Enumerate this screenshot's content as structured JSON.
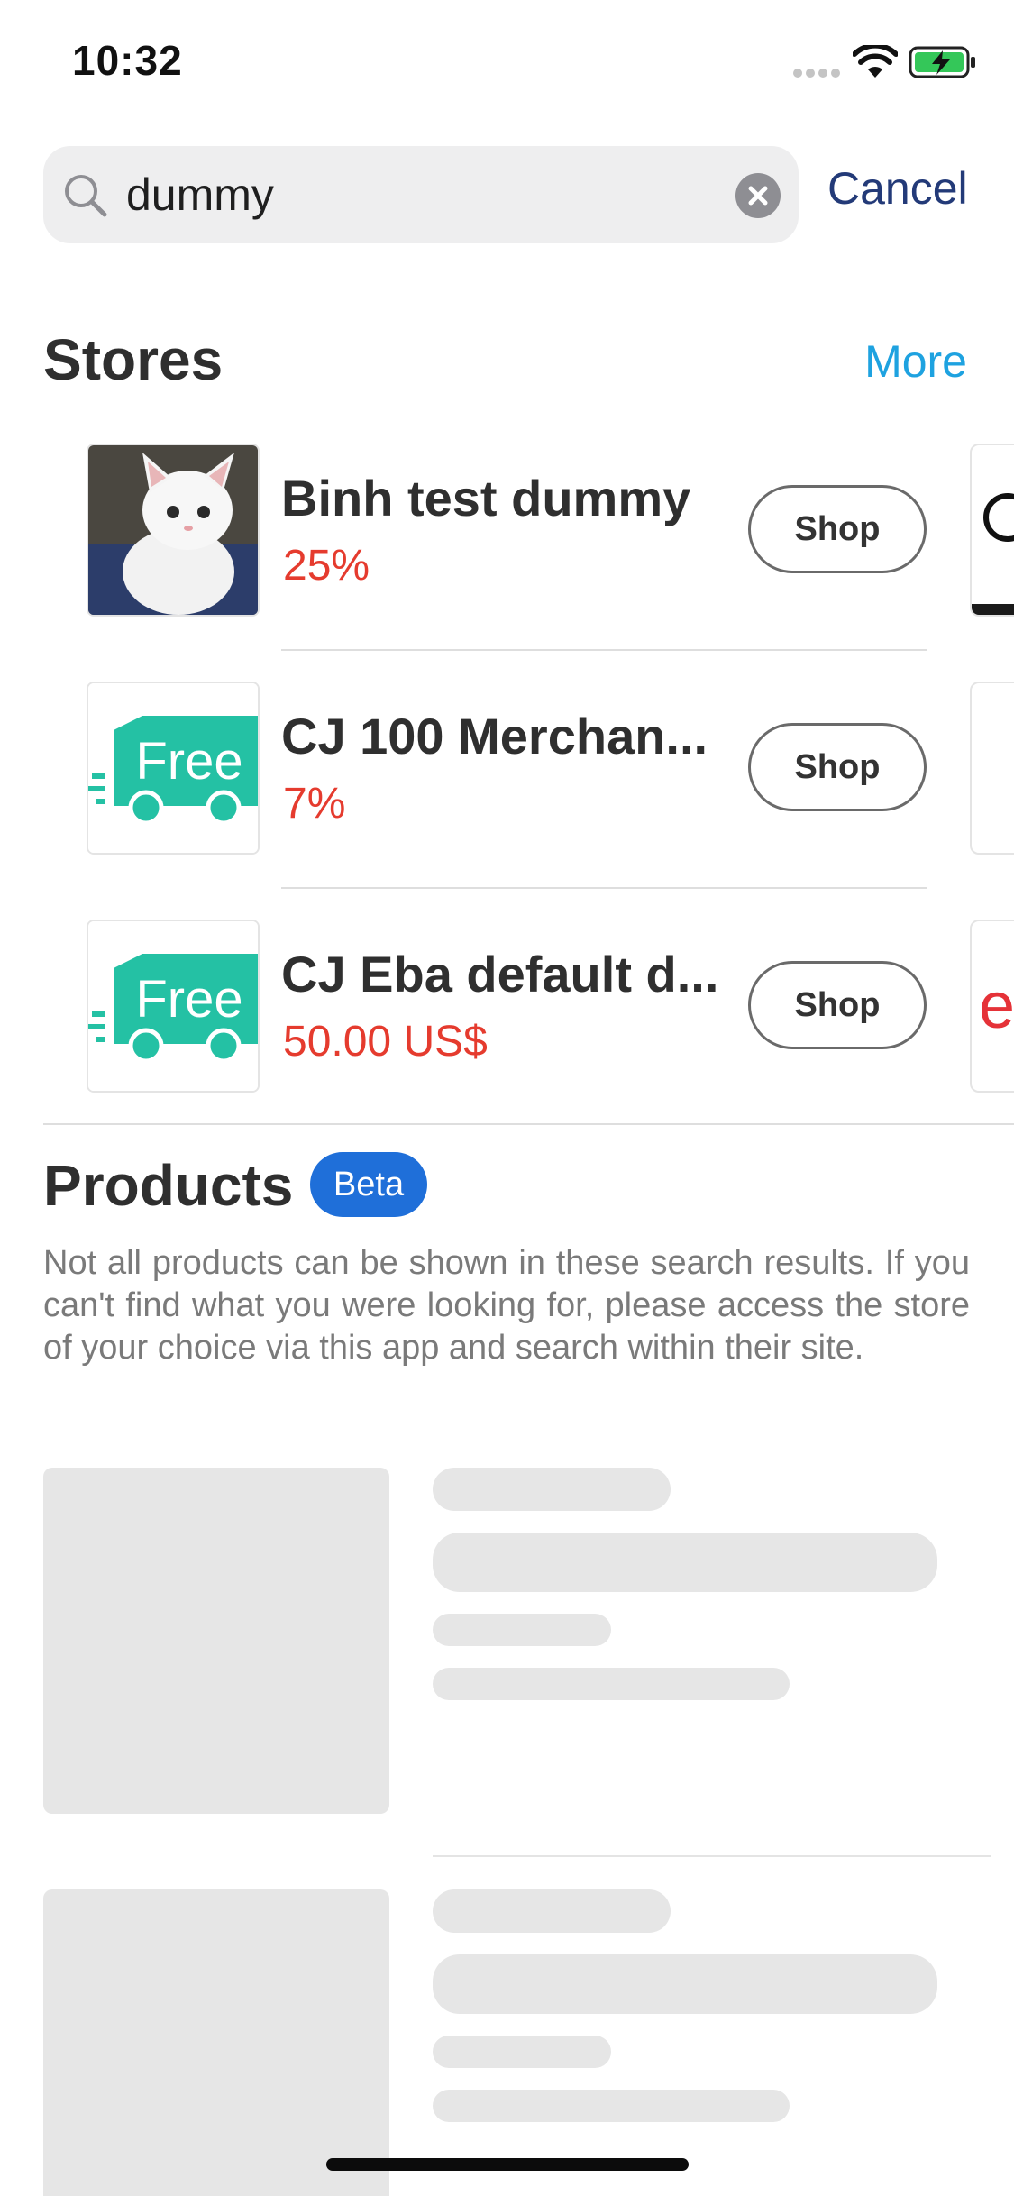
{
  "status_bar": {
    "time": "10:32"
  },
  "search": {
    "value": "dummy",
    "cancel_label": "Cancel"
  },
  "stores": {
    "title": "Stores",
    "more_label": "More",
    "items": [
      {
        "name": "Binh test dummy",
        "cashback": "25%",
        "button": "Shop",
        "image": "kitten-photo"
      },
      {
        "name": "CJ 100 Merchan...",
        "cashback": "7%",
        "button": "Shop",
        "image": "free-shipping-truck"
      },
      {
        "name": "CJ Eba default d...",
        "cashback": "50.00 US$",
        "button": "Shop",
        "image": "free-shipping-truck"
      }
    ]
  },
  "products": {
    "title": "Products",
    "badge": "Beta",
    "disclaimer": "Not all products can be shown in these search results. If you can't find what you were looking for, please access the store of your choice via this app and search within their site."
  },
  "thumbnail_text": {
    "free": "Free",
    "partial_logo": "e"
  },
  "colors": {
    "accent_blue": "#1ea2e0",
    "cancel_blue": "#233a78",
    "cashback_red": "#e53b2e",
    "badge_blue": "#1f6fd9",
    "truck_teal": "#24c1a4",
    "skeleton_gray": "#e6e6e6"
  }
}
